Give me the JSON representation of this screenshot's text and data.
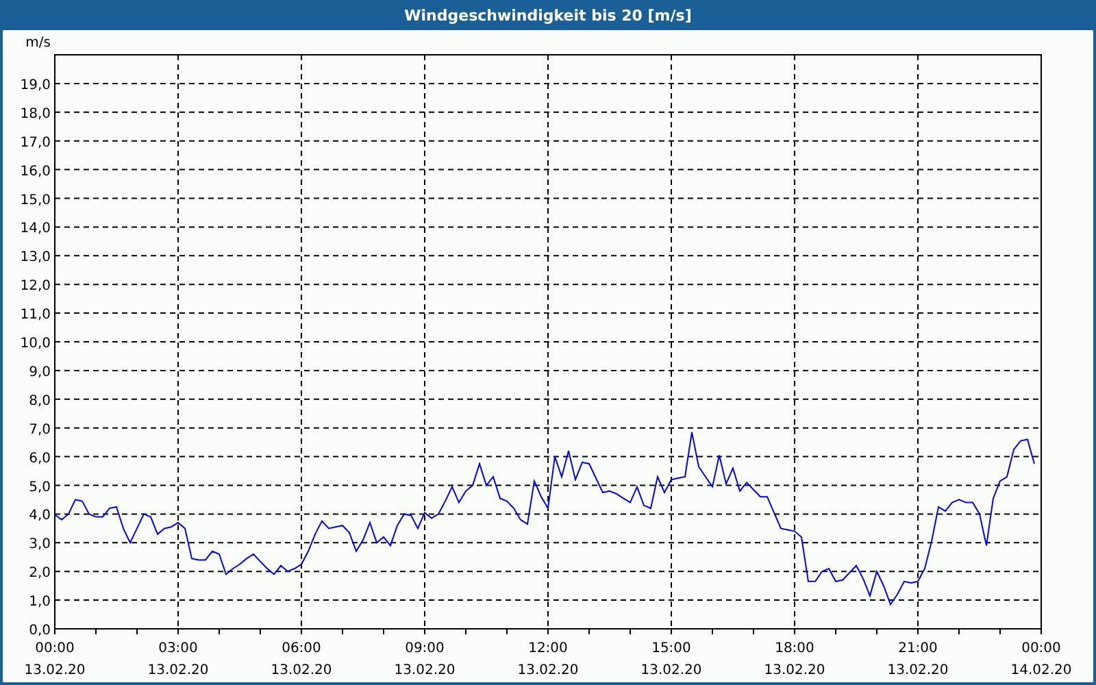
{
  "window": {
    "title": "Windgeschwindigkeit bis 20 [m/s]"
  },
  "chart": {
    "chart_data": {
      "type": "line",
      "ylabel": "m/s",
      "categories": [
        "00:00 13.02.20",
        null,
        null,
        null,
        null,
        null,
        null,
        null,
        null,
        null,
        null,
        null,
        null,
        null,
        null,
        null,
        null,
        null,
        "03:00 13.02.20",
        null,
        null,
        null,
        null,
        null,
        null,
        null,
        null,
        null,
        null,
        null,
        null,
        null,
        null,
        null,
        null,
        null,
        "06:00 13.02.20",
        null,
        null,
        null,
        null,
        null,
        null,
        null,
        null,
        null,
        null,
        null,
        null,
        null,
        null,
        null,
        null,
        null,
        "09:00 13.02.20",
        null,
        null,
        null,
        null,
        null,
        null,
        null,
        null,
        null,
        null,
        null,
        null,
        null,
        null,
        null,
        null,
        null,
        "12:00 13.02.20",
        null,
        null,
        null,
        null,
        null,
        null,
        null,
        null,
        null,
        null,
        null,
        null,
        null,
        null,
        null,
        null,
        null,
        "15:00 13.02.20",
        null,
        null,
        null,
        null,
        null,
        null,
        null,
        null,
        null,
        null,
        null,
        null,
        null,
        null,
        null,
        null,
        null,
        "18:00 13.02.20",
        null,
        null,
        null,
        null,
        null,
        null,
        null,
        null,
        null,
        null,
        null,
        null,
        null,
        null,
        null,
        null,
        null,
        "21:00 13.02.20",
        null,
        null,
        null,
        null,
        null,
        null,
        null,
        null,
        null,
        null,
        null,
        null,
        null,
        null,
        null,
        null,
        null,
        "00:00 14.02.20"
      ],
      "series": [
        {
          "color": "#0000ff",
          "values": [
            3.98,
            3.8,
            4.0,
            4.5,
            4.45,
            4.0,
            3.9,
            3.9,
            4.2,
            4.25,
            3.5,
            3.0,
            3.5,
            4.0,
            3.9,
            3.3,
            3.5,
            3.55,
            3.7,
            3.5,
            2.45,
            2.4,
            2.4,
            2.7,
            2.6,
            1.9,
            2.1,
            2.25,
            2.45,
            2.6,
            2.35,
            2.1,
            1.9,
            2.2,
            2.0,
            2.1,
            2.25,
            2.7,
            3.3,
            3.75,
            3.5,
            3.55,
            3.6,
            3.35,
            2.7,
            3.1,
            3.7,
            3.0,
            3.2,
            2.9,
            3.6,
            4.0,
            3.95,
            3.5,
            4.05,
            3.85,
            4.0,
            4.45,
            4.95,
            4.4,
            4.8,
            5.0,
            5.75,
            5.0,
            5.3,
            4.55,
            4.45,
            4.2,
            3.8,
            3.65,
            5.15,
            4.6,
            4.2,
            6.0,
            5.3,
            6.2,
            5.2,
            5.8,
            5.75,
            5.25,
            4.75,
            4.8,
            4.7,
            4.55,
            4.4,
            4.95,
            4.3,
            4.2,
            5.3,
            4.75,
            5.2,
            5.25,
            5.3,
            6.85,
            5.65,
            5.3,
            4.95,
            6.05,
            5.05,
            5.6,
            4.8,
            5.1,
            4.85,
            4.6,
            4.6,
            4.05,
            3.5,
            3.45,
            3.4,
            3.2,
            1.65,
            1.65,
            2.0,
            2.1,
            1.65,
            1.7,
            1.95,
            2.2,
            1.75,
            1.15,
            2.0,
            1.5,
            0.85,
            1.2,
            1.65,
            1.6,
            1.65,
            2.1,
            3.05,
            4.25,
            4.1,
            4.4,
            4.5,
            4.4,
            4.4,
            4.0,
            2.9,
            4.55,
            5.15,
            5.3,
            6.25,
            6.55,
            6.6,
            5.75,
            null
          ]
        }
      ],
      "ylim": [
        0,
        20
      ],
      "grid": true,
      "yticks": [
        {
          "value": 0,
          "label": "0,0"
        },
        {
          "value": 1,
          "label": "1,0"
        },
        {
          "value": 2,
          "label": "2,0"
        },
        {
          "value": 3,
          "label": "3,0"
        },
        {
          "value": 4,
          "label": "4,0"
        },
        {
          "value": 5,
          "label": "5,0"
        },
        {
          "value": 6,
          "label": "6,0"
        },
        {
          "value": 7,
          "label": "7,0"
        },
        {
          "value": 8,
          "label": "8,0"
        },
        {
          "value": 9,
          "label": "9,0"
        },
        {
          "value": 10,
          "label": "10,0"
        },
        {
          "value": 11,
          "label": "11,0"
        },
        {
          "value": 12,
          "label": "12,0"
        },
        {
          "value": 13,
          "label": "13,0"
        },
        {
          "value": 14,
          "label": "14,0"
        },
        {
          "value": 15,
          "label": "15,0"
        },
        {
          "value": 16,
          "label": "16,0"
        },
        {
          "value": 17,
          "label": "17,0"
        },
        {
          "value": 18,
          "label": "18,0"
        },
        {
          "value": 19,
          "label": "19,0"
        }
      ]
    }
  }
}
